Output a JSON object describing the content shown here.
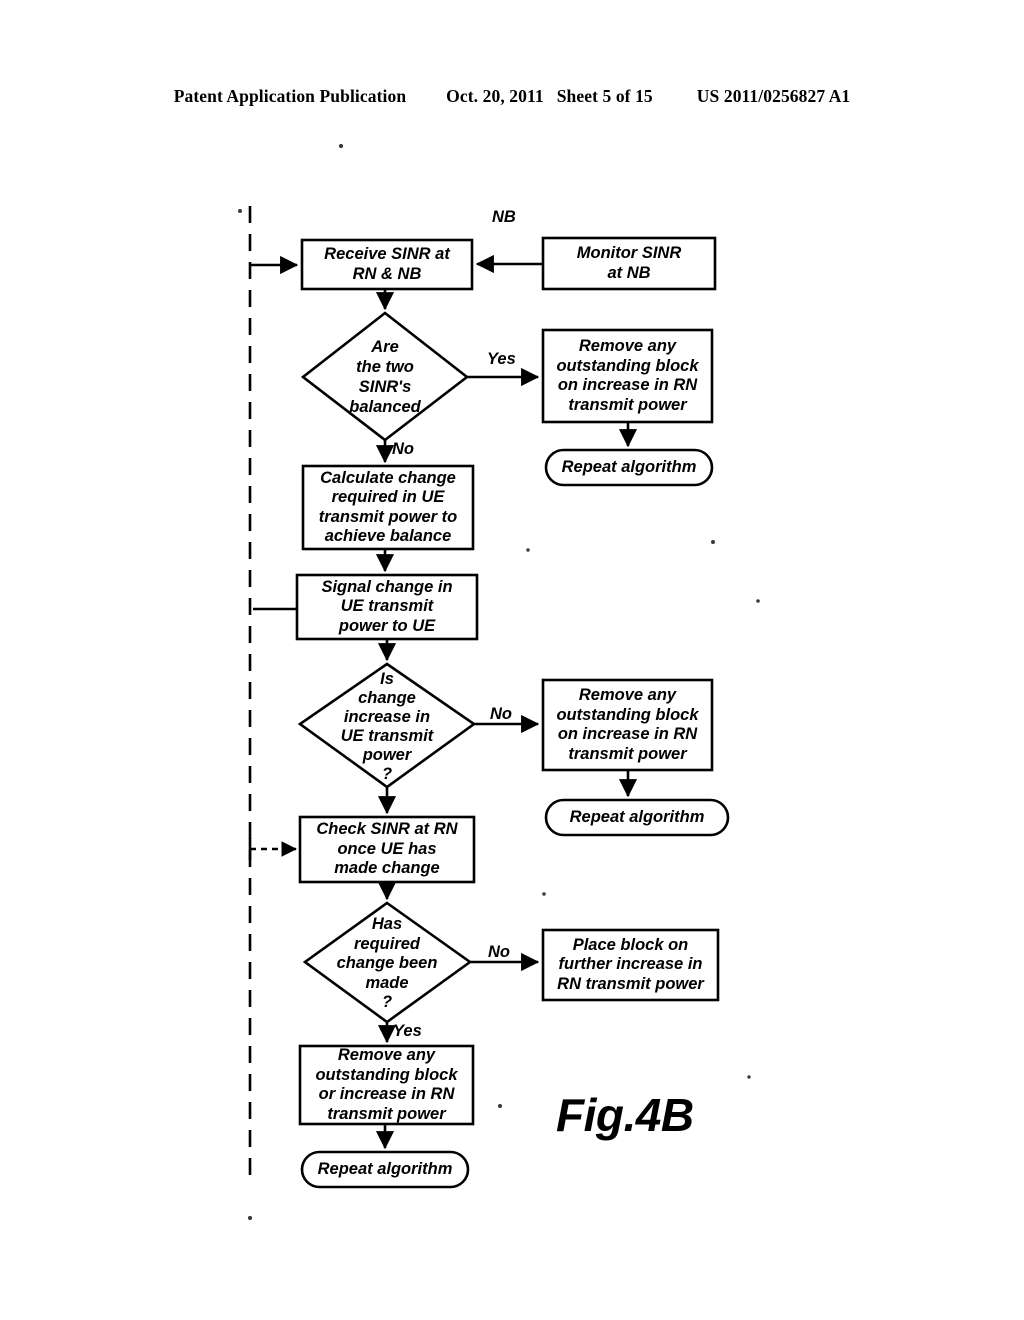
{
  "page": {
    "header": {
      "publication": "Patent Application Publication",
      "date": "Oct. 20, 2011",
      "sheet": "Sheet 5 of 15",
      "patent_number": "US 2011/0256827 A1"
    },
    "figure_caption": "Fig.4B"
  },
  "diagram": {
    "title": "Fig.4B",
    "type": "flowchart",
    "annotations": {
      "nb_label": "NB"
    },
    "nodes": [
      {
        "id": "receive-sinr",
        "shape": "process",
        "text": "Receive SINR at\nRN & NB"
      },
      {
        "id": "monitor-sinr",
        "shape": "process",
        "text": "Monitor SINR\nat NB"
      },
      {
        "id": "are-balanced",
        "shape": "decision",
        "text": "Are\nthe two\nSINR's\nbalanced"
      },
      {
        "id": "remove-block-1",
        "shape": "process",
        "text": "Remove any\noutstanding block\non increase in RN\ntransmit power"
      },
      {
        "id": "repeat-1",
        "shape": "terminator",
        "text": "Repeat algorithm"
      },
      {
        "id": "calculate-change",
        "shape": "process",
        "text": "Calculate change\nrequired in UE\ntransmit power to\nachieve balance"
      },
      {
        "id": "signal-change",
        "shape": "process",
        "text": "Signal change in\nUE transmit\npower to UE"
      },
      {
        "id": "is-increase",
        "shape": "decision",
        "text": "Is\nchange\nincrease in\nUE transmit\npower\n?"
      },
      {
        "id": "remove-block-2",
        "shape": "process",
        "text": "Remove any\noutstanding block\non increase in RN\ntransmit power"
      },
      {
        "id": "repeat-2",
        "shape": "terminator",
        "text": "Repeat algorithm"
      },
      {
        "id": "check-sinr",
        "shape": "process",
        "text": "Check SINR at RN\nonce UE has\nmade change"
      },
      {
        "id": "has-change-made",
        "shape": "decision",
        "text": "Has\nrequired\nchange been\nmade\n?"
      },
      {
        "id": "place-block",
        "shape": "process",
        "text": "Place block on\nfurther increase in\nRN transmit power"
      },
      {
        "id": "remove-block-3",
        "shape": "process",
        "text": "Remove any\noutstanding block\nor increase in RN\ntransmit power"
      },
      {
        "id": "repeat-3",
        "shape": "terminator",
        "text": "Repeat algorithm"
      }
    ],
    "edge_labels": {
      "balanced_yes": "Yes",
      "balanced_no": "No",
      "is_increase_no": "No",
      "has_change_no": "No",
      "has_change_yes": "Yes"
    }
  }
}
